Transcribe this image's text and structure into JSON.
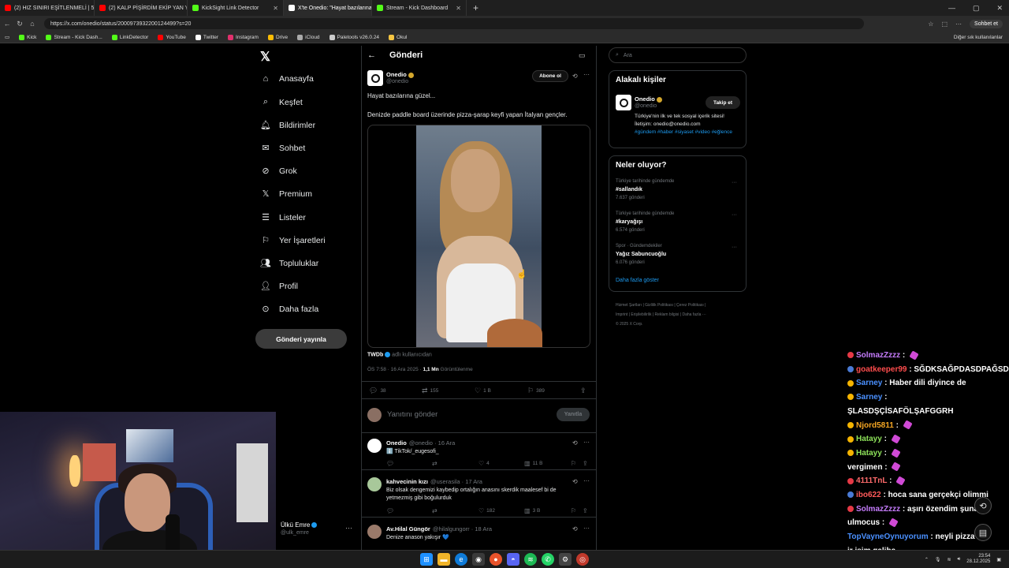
{
  "tabs": [
    {
      "label": "(2) HIZ SINIRI EŞİTLENMELİ | 5Sridi",
      "color": "#ff0000"
    },
    {
      "label": "(2) KALP PİŞİRDİM EKİP YAN YATTI",
      "color": "#ff0000"
    },
    {
      "label": "KickSight Link Detector",
      "color": "#53fc18"
    },
    {
      "label": "X'te Onedio: \"Hayat bazılarına",
      "color": "#ffffff"
    },
    {
      "label": "Stream - Kick Dashboard",
      "color": "#53fc18"
    }
  ],
  "address": {
    "url": "https://x.com/onedio/status/2000973932200124499?s=20",
    "chat_label": "Sohbet et"
  },
  "bookmarks": [
    {
      "label": "Kick",
      "color": "#53fc18"
    },
    {
      "label": "Stream - Kick Dash...",
      "color": "#53fc18"
    },
    {
      "label": "LinkDetector",
      "color": "#53fc18"
    },
    {
      "label": "YouTube",
      "color": "#ff0000"
    },
    {
      "label": "Twitter",
      "color": "#ffffff"
    },
    {
      "label": "Instagram",
      "color": "#e1306c"
    },
    {
      "label": "Drive",
      "color": "#fbbc04"
    },
    {
      "label": "iCloud",
      "color": "#aaaaaa"
    },
    {
      "label": "Paletools v26.0.24",
      "color": "#cccccc"
    },
    {
      "label": "Okul",
      "color": "#f5c542"
    }
  ],
  "bookmarks_other": "Diğer sık kullanılanlar",
  "nav": {
    "items": [
      {
        "label": "Anasayfa",
        "icon": "home-icon"
      },
      {
        "label": "Keşfet",
        "icon": "search-icon"
      },
      {
        "label": "Bildirimler",
        "icon": "bell-icon"
      },
      {
        "label": "Sohbet",
        "icon": "mail-icon"
      },
      {
        "label": "Grok",
        "icon": "grok-icon"
      },
      {
        "label": "Premium",
        "icon": "x-icon"
      },
      {
        "label": "Listeler",
        "icon": "list-icon"
      },
      {
        "label": "Yer İşaretleri",
        "icon": "bookmark-icon"
      },
      {
        "label": "Topluluklar",
        "icon": "people-icon"
      },
      {
        "label": "Profil",
        "icon": "person-icon"
      },
      {
        "label": "Daha fazla",
        "icon": "more-icon"
      }
    ],
    "post_button": "Gönderi yayınla",
    "profile_name": "Ülkü Emre",
    "profile_handle": "@ulk_emre"
  },
  "post": {
    "header_title": "Gönderi",
    "author_name": "Onedio",
    "author_handle": "@onedio",
    "subscribe": "Abone ol",
    "line1": "Hayat bazılarına güzel...",
    "line2": "Denizde paddle board üzerinde pizza-şarap keyfi yapan İtalyan gençler.",
    "source_name": "TWDb",
    "source_suffix": "adlı kullanıcıdan",
    "meta_time": "ÖS 7:58 · 16 Ara 2025 · ",
    "meta_views": "1,1 Mn",
    "meta_views_suffix": " Görüntülenme",
    "stats": {
      "replies": "38",
      "reposts": "155",
      "likes": "1 B",
      "bookmarks": "389"
    },
    "reply_placeholder": "Yanıtını gönder",
    "reply_button": "Yanıtla"
  },
  "comments": [
    {
      "name": "Onedio",
      "handle": "@onedio · 16 Ara",
      "text": "ℹ️ TikTok/_eugesofi_",
      "replies": "",
      "reposts": "",
      "likes": "4",
      "views": "11 B",
      "avatar_color": "#ffffff"
    },
    {
      "name": "kahvecinin kızı",
      "handle": "@userasila · 17 Ara",
      "text": "Biz olsak dengemizi kaybedip ortalığın anasını skerdik maalesef bi de yetmezmiş gibi boğulurduk",
      "replies": "",
      "reposts": "",
      "likes": "182",
      "views": "3 B",
      "avatar_color": "#a8c89a"
    },
    {
      "name": "Av.Hilal Güngör",
      "handle": "@hilalgungorr · 18 Ara",
      "text": "Denize anason yakışır 💙",
      "avatar_color": "#9a7a6a"
    }
  ],
  "right": {
    "search_placeholder": "Ara",
    "related_title": "Alakalı kişiler",
    "related_name": "Onedio",
    "related_handle": "@onedio",
    "follow_label": "Takip et",
    "bio": "Türkiye'nin ilk ve tek sosyal içerik sitesi! İletişim: onedio@onedio.com",
    "bio_tags": "#gündem #haber #siyaset #video #eğlence",
    "trends_title": "Neler oluyor?",
    "trends": [
      {
        "category": "Türkiye tarihinde gündemde",
        "name": "#sallandık",
        "count": "7.637 gönderi"
      },
      {
        "category": "Türkiye tarihinde gündemde",
        "name": "#karyağışı",
        "count": "6.574 gönderi"
      },
      {
        "category": "Spor · Gündemdekiler",
        "name": "Yağız Sabuncuoğlu",
        "count": "6.076 gönderi"
      }
    ],
    "show_more": "Daha fazla göster",
    "footer_line1": "Hizmet Şartları  |  Gizlilik Politikası  |  Çerez Politikası  |",
    "footer_line2": "Imprint  |  Erişilebilirlik  |  Reklam bilgisi  |  Daha fazla ···",
    "footer_line3": "© 2025 X Corp."
  },
  "chat": [
    {
      "user": "SolmazZzzz",
      "color": "#c77dff",
      "msg": "",
      "emote": true,
      "badge": "#e63946"
    },
    {
      "user": "goatkeeper99",
      "color": "#ff4d4d",
      "msg": "SĞDKSAĞPDASDPAĞSD",
      "emote": false,
      "badge": "#4a7bd6"
    },
    {
      "user": "Sarney",
      "color": "#4a90ff",
      "msg": "Haber dili diyince de",
      "emote": false,
      "badge": "#f5b400"
    },
    {
      "user": "Sarney",
      "color": "#4a90ff",
      "msg": "",
      "emote": false,
      "badge": "#f5b400"
    },
    {
      "user": "",
      "color": "#ffffff",
      "msg": "ŞLASDŞÇİSAFÖLŞAFGGRH",
      "emote": false,
      "badge": ""
    },
    {
      "user": "Njord5811",
      "color": "#f5a623",
      "msg": "",
      "emote": true,
      "badge": "#f5b400"
    },
    {
      "user": "Hatayy",
      "color": "#8ee35a",
      "msg": "",
      "emote": true,
      "badge": "#f5b400"
    },
    {
      "user": "Hatayy",
      "color": "#8ee35a",
      "msg": "",
      "emote": true,
      "badge": "#f5b400"
    },
    {
      "user": "vergimen",
      "color": "#ffffff",
      "msg": "",
      "emote": true,
      "badge": ""
    },
    {
      "user": "4111TnL",
      "color": "#ff6b6b",
      "msg": "",
      "emote": true,
      "badge": "#e63946"
    },
    {
      "user": "ibo622",
      "color": "#ff5a5a",
      "msg": "hoca sana gerçekçi olimmi",
      "emote": false,
      "badge": "#4a7bd6"
    },
    {
      "user": "SolmazZzzz",
      "color": "#c77dff",
      "msg": "aşırı özendim şuna",
      "emote": false,
      "badge": "#e63946"
    },
    {
      "user": "ulmocus",
      "color": "#ffffff",
      "msg": "",
      "emote": true,
      "badge": ""
    },
    {
      "user": "TopVayneOynuyorum",
      "color": "#4a90ff",
      "msg": "neyli pizza la",
      "emote": false,
      "badge": ""
    },
    {
      "user": "",
      "color": "#ffffff",
      "msg": "ir isim galiba",
      "emote": false,
      "badge": ""
    }
  ],
  "taskbar": {
    "time": "23:54",
    "date": "28.12.2025"
  }
}
